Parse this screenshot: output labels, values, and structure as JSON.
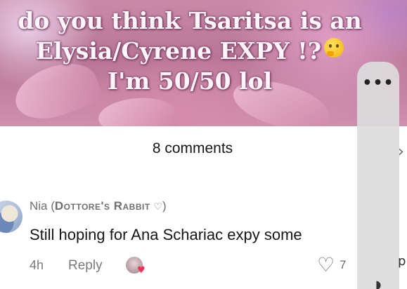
{
  "video": {
    "caption_line1": "do you think Tsaritsa is an",
    "caption_line2": "Elysia/Cyrene EXPY !?",
    "caption_line3": "I'm 50/50 lol",
    "caption_emoji": "thinking-face-icon"
  },
  "comments_panel": {
    "count_label": "8 comments"
  },
  "comment": {
    "author_name": "Nia (",
    "author_tag": "Dottore's Rabbit",
    "author_suffix": ")",
    "text": "Still hoping for Ana Schariac expy some",
    "time": "4h",
    "reply_label": "Reply",
    "likes": "7"
  },
  "overlay": {
    "more_label": "•••",
    "edge_p": "p"
  },
  "colors": {
    "liked_by_creator_heart": "#fe2c55",
    "text_primary": "#161616",
    "text_secondary": "#7a7a7a"
  }
}
